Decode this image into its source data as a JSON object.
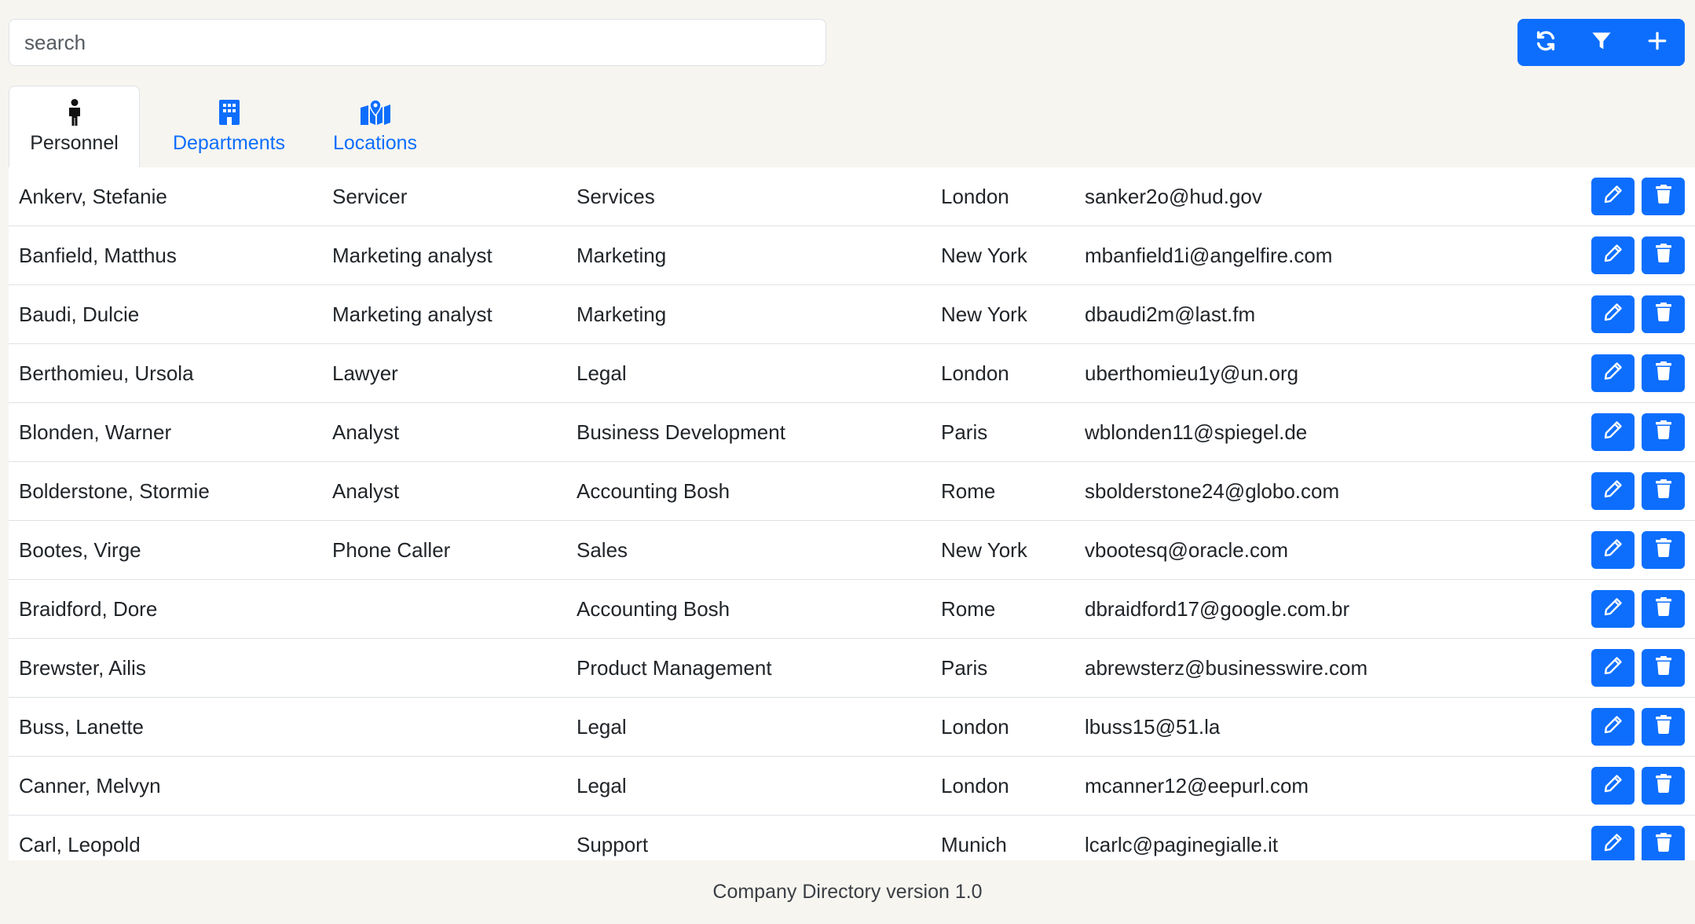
{
  "search": {
    "placeholder": "search",
    "value": ""
  },
  "toolbar": {
    "buttons": [
      {
        "name": "refresh-button",
        "icon": "refresh-icon"
      },
      {
        "name": "filter-button",
        "icon": "filter-icon"
      },
      {
        "name": "add-button",
        "icon": "plus-icon"
      }
    ]
  },
  "tabs": [
    {
      "label": "Personnel",
      "icon": "person-icon",
      "active": true
    },
    {
      "label": "Departments",
      "icon": "building-icon",
      "active": false
    },
    {
      "label": "Locations",
      "icon": "map-location-icon",
      "active": false
    }
  ],
  "personnel": [
    {
      "name": "Ankerv, Stefanie",
      "job": "Servicer",
      "department": "Services",
      "location": "London",
      "email": "sanker2o@hud.gov"
    },
    {
      "name": "Banfield, Matthus",
      "job": "Marketing analyst",
      "department": "Marketing",
      "location": "New York",
      "email": "mbanfield1i@angelfire.com"
    },
    {
      "name": "Baudi, Dulcie",
      "job": "Marketing analyst",
      "department": "Marketing",
      "location": "New York",
      "email": "dbaudi2m@last.fm"
    },
    {
      "name": "Berthomieu, Ursola",
      "job": "Lawyer",
      "department": "Legal",
      "location": "London",
      "email": "uberthomieu1y@un.org"
    },
    {
      "name": "Blonden, Warner",
      "job": "Analyst",
      "department": "Business Development",
      "location": "Paris",
      "email": "wblonden11@spiegel.de"
    },
    {
      "name": "Bolderstone, Stormie",
      "job": "Analyst",
      "department": "Accounting Bosh",
      "location": "Rome",
      "email": "sbolderstone24@globo.com"
    },
    {
      "name": "Bootes, Virge",
      "job": "Phone Caller",
      "department": "Sales",
      "location": "New York",
      "email": "vbootesq@oracle.com"
    },
    {
      "name": "Braidford, Dore",
      "job": "",
      "department": "Accounting Bosh",
      "location": "Rome",
      "email": "dbraidford17@google.com.br"
    },
    {
      "name": "Brewster, Ailis",
      "job": "",
      "department": "Product Management",
      "location": "Paris",
      "email": "abrewsterz@businesswire.com"
    },
    {
      "name": "Buss, Lanette",
      "job": "",
      "department": "Legal",
      "location": "London",
      "email": "lbuss15@51.la"
    },
    {
      "name": "Canner, Melvyn",
      "job": "",
      "department": "Legal",
      "location": "London",
      "email": "mcanner12@eepurl.com"
    },
    {
      "name": "Carl, Leopold",
      "job": "",
      "department": "Support",
      "location": "Munich",
      "email": "lcarlc@paginegialle.it"
    }
  ],
  "row_actions": {
    "edit_icon": "pencil-icon",
    "delete_icon": "trash-icon"
  },
  "footer": {
    "text": "Company Directory version 1.0"
  },
  "colors": {
    "primary": "#0d6efd",
    "background": "#f7f5f0",
    "surface": "#ffffff",
    "border": "#dee2e6"
  }
}
